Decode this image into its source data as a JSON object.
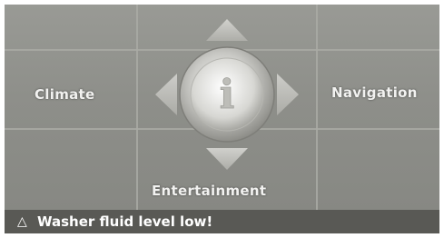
{
  "menu": {
    "left_label": "Climate",
    "right_label": "Navigation",
    "bottom_label": "Entertainment",
    "center_icon": "info-icon",
    "center_glyph": "i"
  },
  "status": {
    "icon": "warning-triangle-icon",
    "icon_glyph": "△",
    "message": "Washer fluid level low!"
  },
  "colors": {
    "background": "#8e8f8a",
    "status_bar": "#595955",
    "label_text": "#f2f2f0"
  }
}
